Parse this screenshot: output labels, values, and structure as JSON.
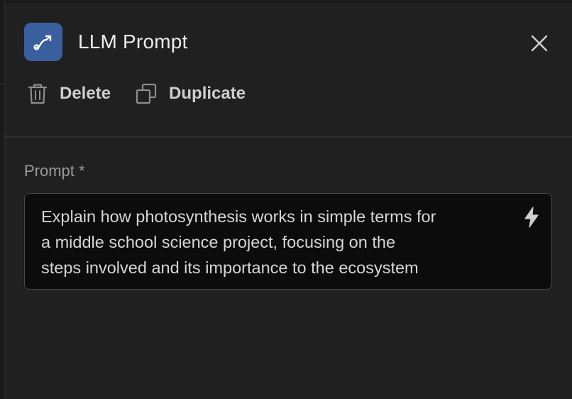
{
  "panel": {
    "title": "LLM Prompt",
    "icon": "route-icon",
    "accent_color": "#3a5f9e"
  },
  "actions": {
    "delete_label": "Delete",
    "duplicate_label": "Duplicate"
  },
  "prompt_field": {
    "label": "Prompt *",
    "value": "Explain how photosynthesis works in simple terms for\na middle school science project, focusing on the\nsteps involved and its importance to the ecosystem"
  }
}
